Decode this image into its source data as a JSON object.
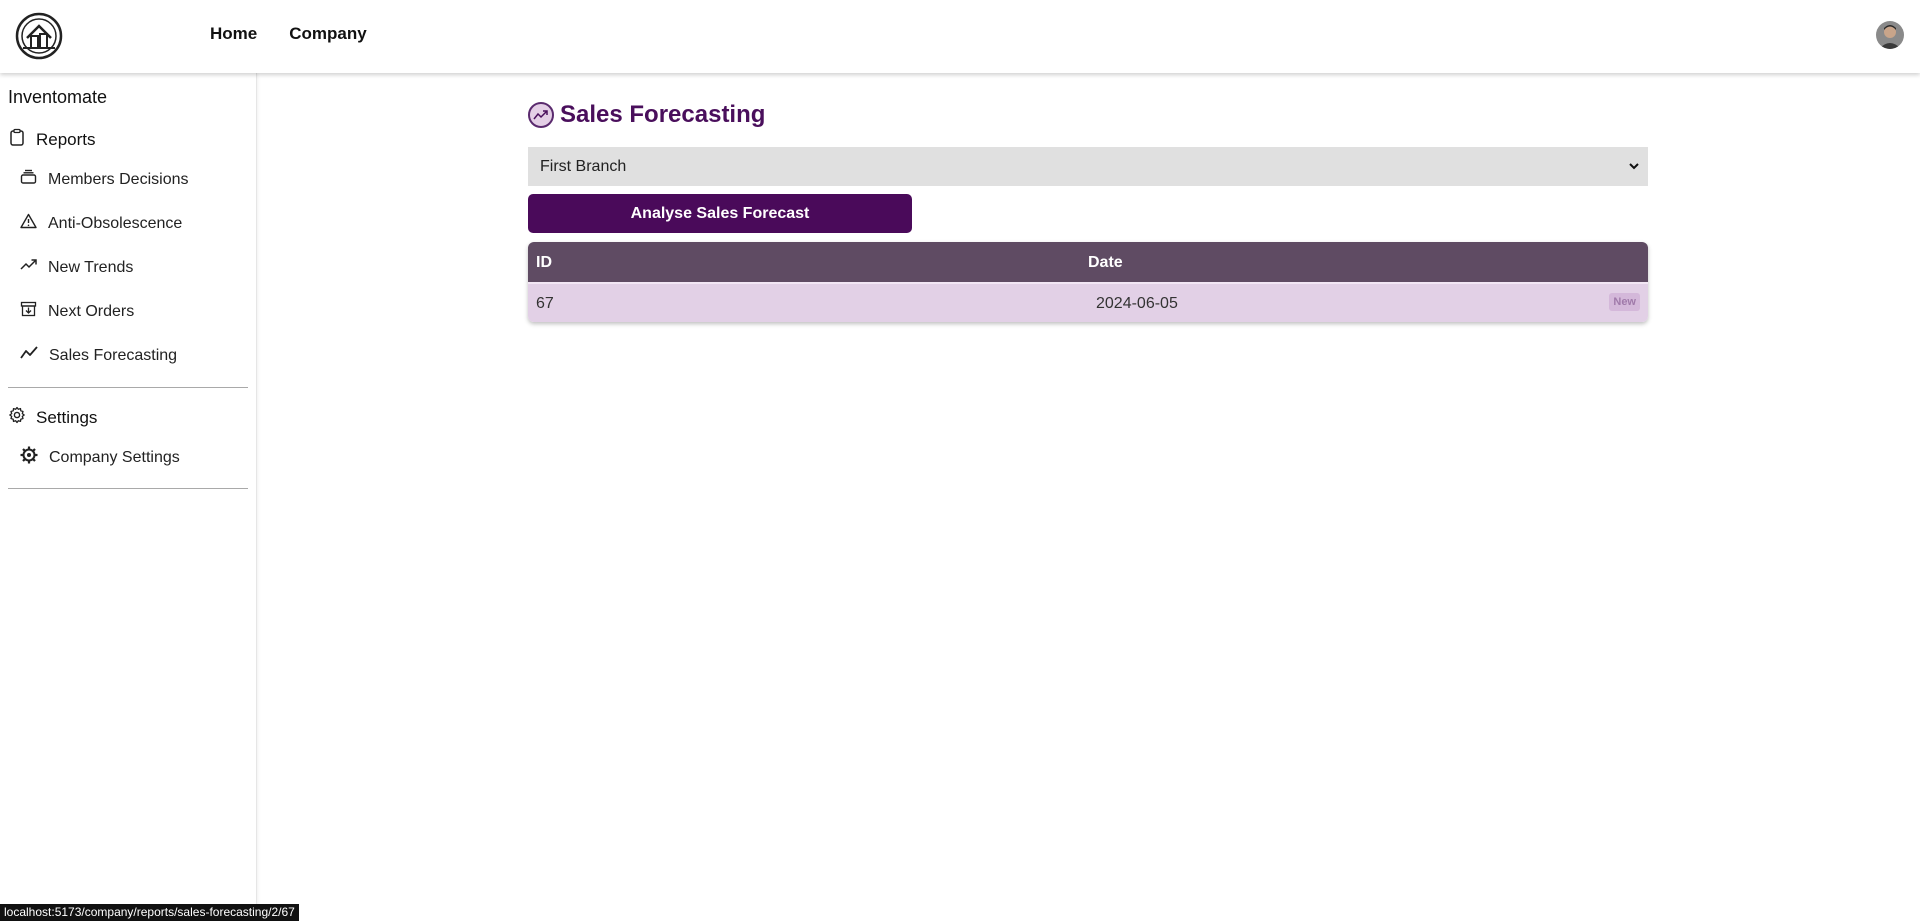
{
  "header": {
    "logo_icon": "house-logo-icon",
    "nav": [
      {
        "label": "Home"
      },
      {
        "label": "Company"
      }
    ],
    "avatar_icon": "user-avatar"
  },
  "sidebar": {
    "app_name": "Inventomate",
    "reports": {
      "label": "Reports",
      "icon": "clipboard-icon",
      "items": [
        {
          "label": "Members Decisions",
          "icon": "layers-icon"
        },
        {
          "label": "Anti-Obsolescence",
          "icon": "warning-icon"
        },
        {
          "label": "New Trends",
          "icon": "trending-up-icon"
        },
        {
          "label": "Next Orders",
          "icon": "archive-down-icon"
        },
        {
          "label": "Sales Forecasting",
          "icon": "line-chart-icon"
        }
      ]
    },
    "settings": {
      "label": "Settings",
      "icon": "gear-icon",
      "items": [
        {
          "label": "Company Settings",
          "icon": "cog-icon"
        }
      ]
    }
  },
  "main": {
    "title": "Sales Forecasting",
    "title_icon": "trending-up-icon",
    "branch_select": {
      "selected": "First Branch"
    },
    "analyse_button": "Analyse Sales Forecast",
    "table": {
      "columns": [
        "ID",
        "Date"
      ],
      "rows": [
        {
          "id": "67",
          "date": "2024-06-05",
          "badge": "New"
        }
      ]
    }
  },
  "status_bar": {
    "url": "localhost:5173/company/reports/sales-forecasting/2/67"
  },
  "colors": {
    "brand": "#4a0a5a",
    "table_header": "#5f4b63",
    "table_row": "#e2d0e6"
  }
}
